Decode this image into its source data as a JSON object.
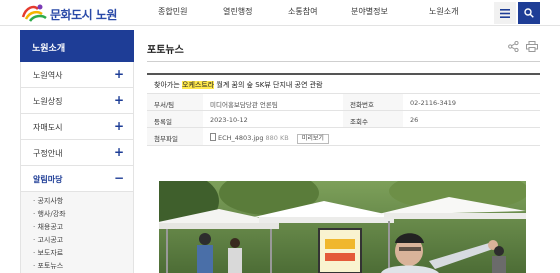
{
  "header": {
    "logo_text": "문화도시 노원",
    "nav": [
      "종합민원",
      "열린행정",
      "소통참여",
      "분야별정보",
      "노원소개"
    ],
    "all_menu_icon": "hamburger-icon",
    "search_icon": "search-icon"
  },
  "sidebar": {
    "title": "노원소개",
    "items": [
      {
        "label": "노원역사",
        "toggle": "+"
      },
      {
        "label": "노원상징",
        "toggle": "+"
      },
      {
        "label": "자매도시",
        "toggle": "+"
      },
      {
        "label": "구정안내",
        "toggle": "+"
      },
      {
        "label": "알림마당",
        "toggle": "−"
      }
    ],
    "sub_items": [
      "공지사항",
      "행사/강좌",
      "채용공고",
      "고시공고",
      "보도자료",
      "포토뉴스"
    ]
  },
  "content": {
    "title": "포토뉴스",
    "share_icon": "share-icon",
    "print_icon": "print-icon"
  },
  "post": {
    "title_before": "찾아가는 ",
    "title_highlight": "오케스트라",
    "title_after": " 월계 꿈의 숲 SK뷰 단지내 공연 관람",
    "dept_label": "부서/팀",
    "dept_value": "미디어홍보담당관 언론팀",
    "phone_label": "전화번호",
    "phone_value": "02-2116-3419",
    "date_label": "등록일",
    "date_value": "2023-10-12",
    "views_label": "조회수",
    "views_value": "26",
    "file_label": "첨부파일",
    "file_name": "ECH_4803.jpg",
    "file_size": "880 KB",
    "preview_label": "미리보기"
  },
  "colors": {
    "brand": "#1e3d96",
    "highlight": "#ffe84d"
  }
}
